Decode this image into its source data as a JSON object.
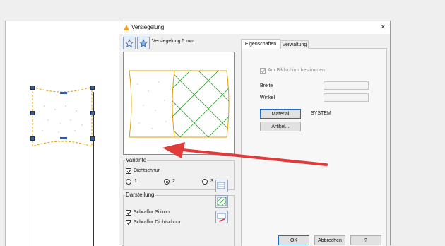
{
  "dialog": {
    "title": "Versiegelung",
    "close": "✕",
    "profile_name": "Versiegelung 5 mm"
  },
  "variante": {
    "label": "Variante",
    "dichtschnur_label": "Dichtschnur",
    "dichtschnur_checked": true,
    "options": [
      "1",
      "2",
      "3"
    ],
    "selected": "2"
  },
  "darstellung": {
    "label": "Darstellung",
    "schraffur_silikon": "Schraffur Silikon",
    "schraffur_dichtschnur": "Schraffur Dichtschnur"
  },
  "tabs": [
    "Eigenschaften",
    "Verwaltung"
  ],
  "active_tab": "Eigenschaften",
  "props": {
    "am_bildschirm": "Am Bildschirm bestimmen",
    "breite": "Breite",
    "winkel": "Winkel",
    "material_btn": "Material",
    "material_value": "SYSTEM",
    "artikel_btn": "Artikel..."
  },
  "footer": {
    "ok": "OK",
    "abbrechen": "Abbrechen",
    "help": "?"
  },
  "colors": {
    "seal_outline": "#e0a000",
    "hatch": "#2aa52a",
    "arrow": "#e03a3a"
  }
}
